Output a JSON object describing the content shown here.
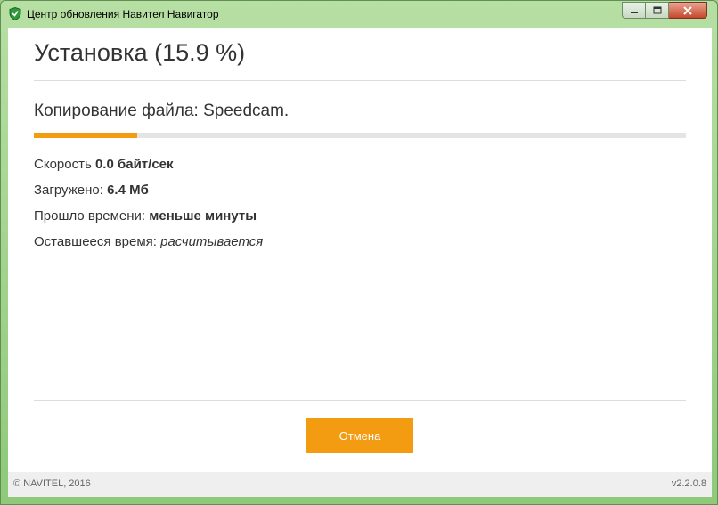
{
  "window": {
    "title": "Центр обновления Навител Навигатор"
  },
  "main": {
    "heading": "Установка (15.9 %)",
    "status": "Копирование файла: Speedcam.",
    "progress": 0.159,
    "stats": {
      "speed_label": "Скорость ",
      "speed_value": "0.0 байт/сек",
      "downloaded_label": "Загружено: ",
      "downloaded_value": "6.4 Мб",
      "elapsed_label": "Прошло времени: ",
      "elapsed_value": "меньше минуты",
      "remaining_label": "Оставшееся время: ",
      "remaining_value": "расчитывается"
    },
    "cancel_label": "Отмена"
  },
  "footer": {
    "copyright": "© NAVITEL, 2016",
    "version": "v2.2.0.8"
  },
  "colors": {
    "accent": "#f39c12",
    "title_bar": "#9fcf8a",
    "text": "#333333"
  },
  "icons": {
    "app": "navitel-shield-icon",
    "minimize": "minimize-icon",
    "maximize": "maximize-icon",
    "close": "close-icon"
  }
}
